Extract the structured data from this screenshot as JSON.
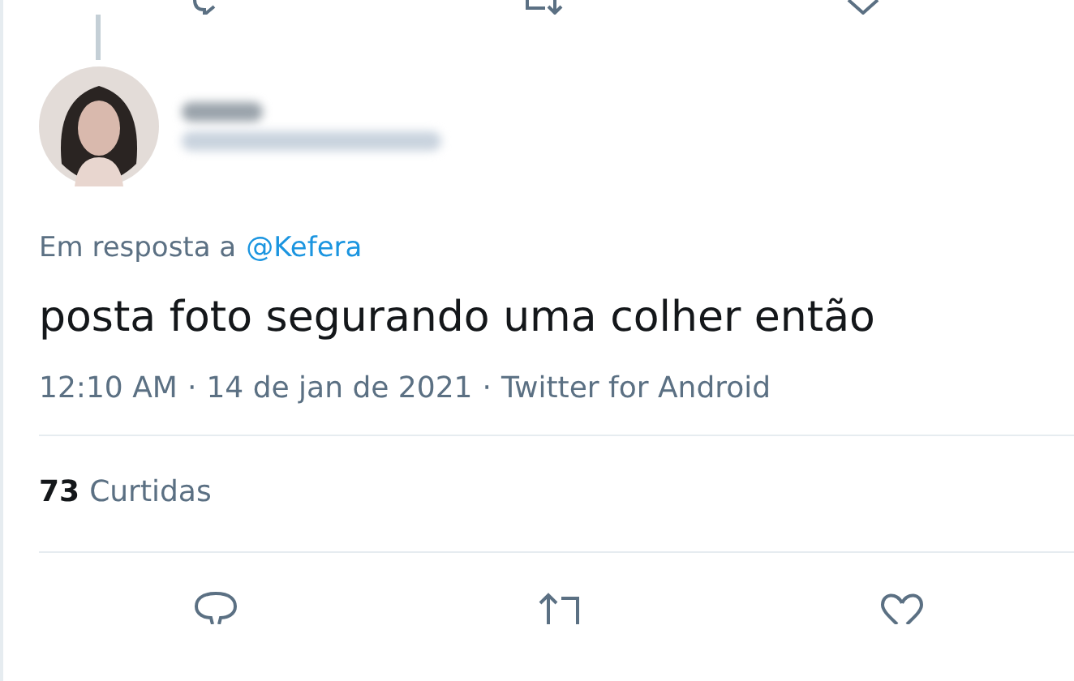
{
  "reply_to": {
    "prefix": "Em resposta a",
    "mention": "@Kefera"
  },
  "text": "posta foto segurando uma colher então",
  "meta": [
    "12:10 AM",
    "·",
    "14 de jan de 2021",
    "·",
    "Twitter for Android"
  ],
  "likes": {
    "count": "73",
    "label": "Curtidas"
  }
}
